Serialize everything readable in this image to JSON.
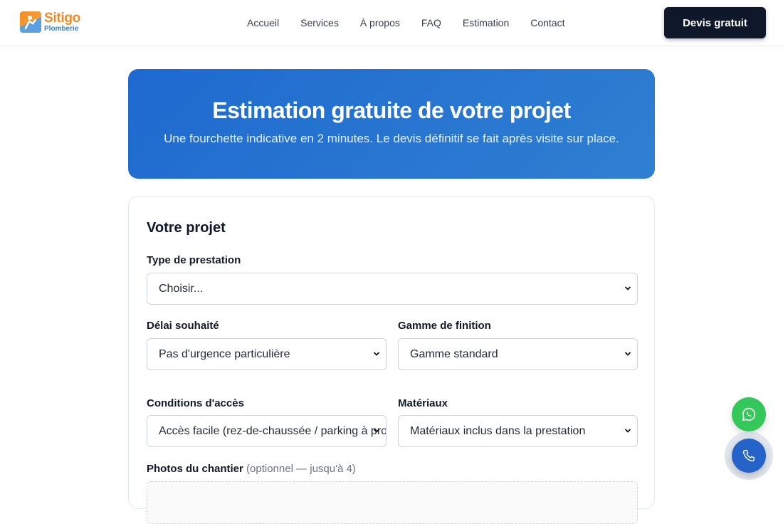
{
  "header": {
    "logo_name": "Sitigo",
    "logo_sub": "Plomberie",
    "nav": [
      "Accueil",
      "Services",
      "À propos",
      "FAQ",
      "Estimation",
      "Contact"
    ],
    "cta_label": "Devis gratuit"
  },
  "hero": {
    "title": "Estimation gratuite de votre projet",
    "subtitle": "Une fourchette indicative en 2 minutes. Le devis définitif se fait après visite sur place."
  },
  "form": {
    "title": "Votre projet",
    "type_label": "Type de prestation",
    "type_value": "Choisir...",
    "delai_label": "Délai souhaité",
    "delai_value": "Pas d'urgence particulière",
    "gamme_label": "Gamme de finition",
    "gamme_value": "Gamme standard",
    "acces_label": "Conditions d'accès",
    "acces_value": "Accès facile (rez-de-chaussée / parking à proximité)",
    "materiaux_label": "Matériaux",
    "materiaux_value": "Matériaux inclus dans la prestation",
    "photos_label": "Photos du chantier",
    "photos_hint": "(optionnel — jusqu'à 4)"
  },
  "colors": {
    "accent": "#1e6ad0",
    "logo_orange": "#f08a24",
    "whatsapp": "#34c759",
    "phone": "#2563c9",
    "dark": "#0f172a"
  },
  "icons": {
    "whatsapp": "whatsapp-icon",
    "phone": "phone-icon",
    "chevron": "chevron-down-icon",
    "logo": "plumber-logo-icon"
  }
}
